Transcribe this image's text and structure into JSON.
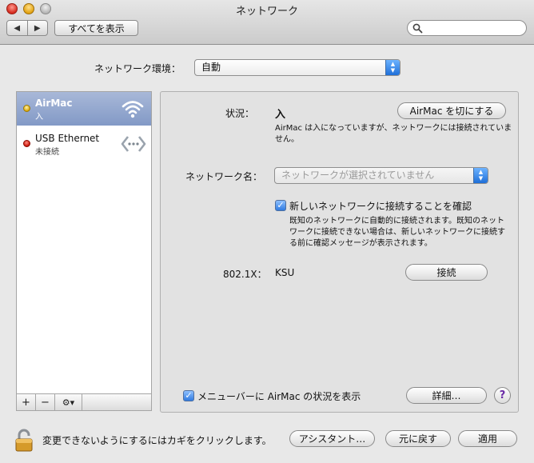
{
  "window": {
    "title": "ネットワーク"
  },
  "toolbar": {
    "back_glyph": "◀",
    "forward_glyph": "▶",
    "show_all_label": "すべてを表示",
    "search_placeholder": ""
  },
  "location": {
    "label": "ネットワーク環境：",
    "value": "自動"
  },
  "services": [
    {
      "name": "AirMac",
      "status": "入",
      "status_color": "#d8a300",
      "icon": "wifi-icon",
      "selected": true
    },
    {
      "name": "USB Ethernet",
      "status": "未接続",
      "status_color": "#c40d00",
      "icon": "ethernet-icon",
      "selected": false
    }
  ],
  "sidebar_buttons": {
    "add": "+",
    "remove": "−",
    "gear": "⚙▾"
  },
  "detail": {
    "status_label": "状況：",
    "status_value": "入",
    "airmac_off_label": "AirMac を切にする",
    "status_description": "AirMac は入になっていますが、ネットワークには接続されていません。",
    "network_name_label": "ネットワーク名：",
    "network_name_placeholder": "ネットワークが選択されていません",
    "confirm_checkbox_label": "新しいネットワークに接続することを確認",
    "confirm_checked": true,
    "confirm_description": "既知のネットワークに自動的に接続されます。既知のネットワークに接続できない場合は、新しいネットワークに接続する前に確認メッセージが表示されます。",
    "dot1x_label": "802.1X：",
    "dot1x_value": "KSU",
    "connect_label": "接続",
    "menubar_checkbox_label": "メニューバーに AirMac の状況を表示",
    "menubar_checked": true,
    "advanced_label": "詳細…",
    "help_label": "?"
  },
  "footer": {
    "lock_text": "変更できないようにするにはカギをクリックします。",
    "assistant_label": "アシスタント…",
    "revert_label": "元に戻す",
    "apply_label": "適用"
  },
  "colors": {
    "selection": "#8299c6",
    "accent": "#2f7ae0"
  }
}
